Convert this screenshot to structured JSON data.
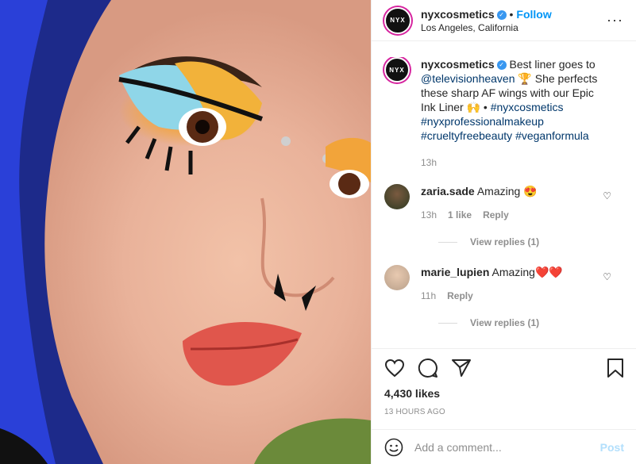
{
  "post": {
    "username": "nyxcosmetics",
    "follow_label": "Follow",
    "location": "Los Angeles, California",
    "avatar_text": "NYX",
    "caption_text": "Best liner goes to",
    "caption_mention": "@televisionheaven",
    "caption_mid": "She perfects these sharp AF wings with our Epic Ink Liner",
    "caption_tags": [
      "#nyxcosmetics",
      "#nyxprofessionalmakeup",
      "#crueltyfreebeauty",
      "#veganformula"
    ],
    "caption_time": "13h"
  },
  "comments": [
    {
      "user": "zaria.sade",
      "text": "Amazing",
      "emoji": "😍",
      "time": "13h",
      "likes": "1 like",
      "reply": "Reply",
      "view_replies": "View replies (1)"
    },
    {
      "user": "marie_lupien",
      "text": "Amazing",
      "emoji": "❤️❤️",
      "time": "11h",
      "reply": "Reply",
      "view_replies": "View replies (1)"
    }
  ],
  "likes_count": "4,430 likes",
  "timestamp": "13 HOURS AGO",
  "add_comment": {
    "placeholder": "Add a comment...",
    "post_label": "Post"
  },
  "colors": {
    "accent": "#0095f6",
    "link": "#00376b",
    "muted": "#8e8e8e"
  }
}
